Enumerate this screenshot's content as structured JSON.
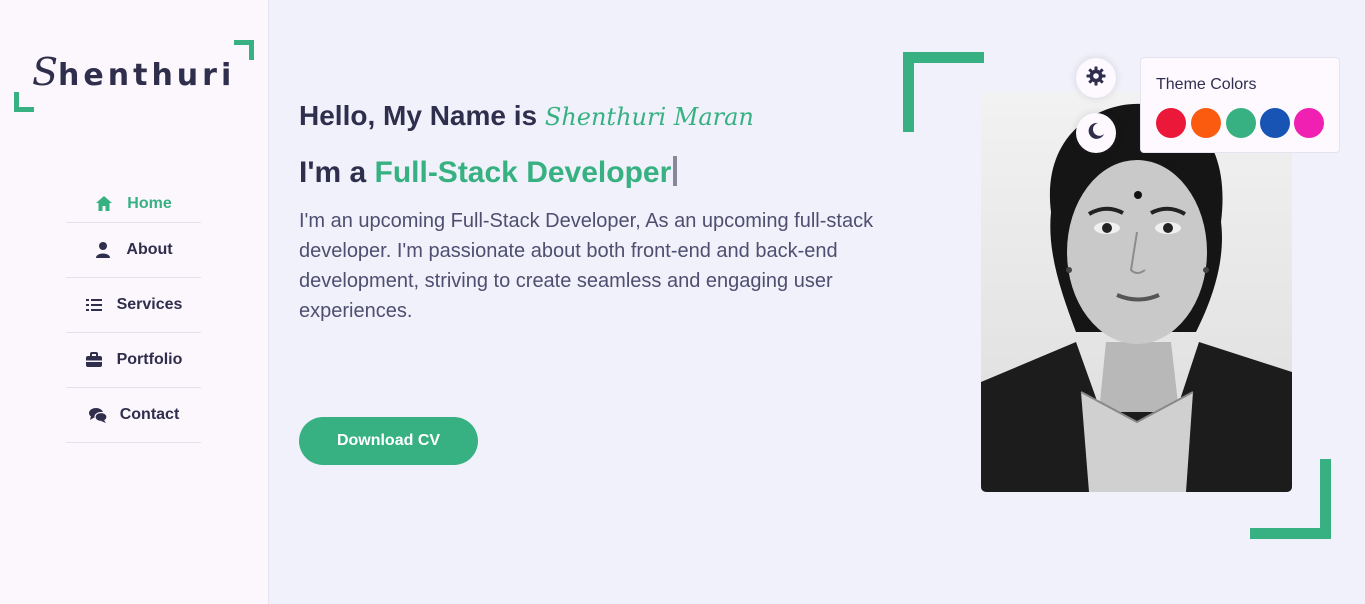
{
  "brand": {
    "logo_first": "S",
    "logo_rest": "henthuri"
  },
  "nav": [
    {
      "label": "Home",
      "icon": "home-icon",
      "active": true
    },
    {
      "label": "About",
      "icon": "user-icon",
      "active": false
    },
    {
      "label": "Services",
      "icon": "list-icon",
      "active": false
    },
    {
      "label": "Portfolio",
      "icon": "briefcase-icon",
      "active": false
    },
    {
      "label": "Contact",
      "icon": "comments-icon",
      "active": false
    }
  ],
  "hero": {
    "greeting": "Hello, My Name is ",
    "name": "Shenthuri Maran",
    "role_prefix": "I'm a ",
    "role": "Full-Stack Developer",
    "description": "I'm an upcoming Full-Stack Developer, As an upcoming full-stack developer. I'm passionate about both front-end and back-end development, striving to create seamless and engaging user experiences.",
    "cta": "Download CV"
  },
  "style_switcher": {
    "title": "Theme Colors",
    "colors": [
      "#ec1839",
      "#fa5b0f",
      "#37b182",
      "#1854b4",
      "#f021b2"
    ]
  },
  "colors": {
    "accent": "#37b182",
    "text": "#302e4d",
    "background": "#f0f1fa"
  }
}
